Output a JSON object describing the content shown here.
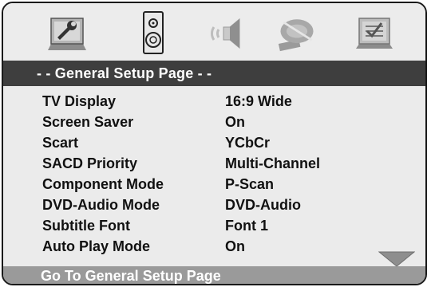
{
  "tabs": [
    {
      "icon": "wrench-setup-icon",
      "name": "general"
    },
    {
      "icon": "speaker-icon",
      "name": "speaker"
    },
    {
      "icon": "audio-sound-icon",
      "name": "audio"
    },
    {
      "icon": "video-disc-icon",
      "name": "video"
    },
    {
      "icon": "preference-check-icon",
      "name": "preference"
    }
  ],
  "page_title": "- - General Setup Page - -",
  "settings": [
    {
      "label": "TV Display",
      "value": "16:9 Wide"
    },
    {
      "label": "Screen Saver",
      "value": "On"
    },
    {
      "label": "Scart",
      "value": "YCbCr"
    },
    {
      "label": "SACD Priority",
      "value": "Multi-Channel"
    },
    {
      "label": "Component Mode",
      "value": "P-Scan"
    },
    {
      "label": "DVD-Audio Mode",
      "value": "DVD-Audio"
    },
    {
      "label": "Subtitle Font",
      "value": "Font 1"
    },
    {
      "label": "Auto Play Mode",
      "value": "On"
    }
  ],
  "status": "Go To General Setup Page",
  "colors": {
    "header_bar": "#3e3e3e",
    "status_bar": "#9a9a9a",
    "background": "#ebebeb"
  }
}
